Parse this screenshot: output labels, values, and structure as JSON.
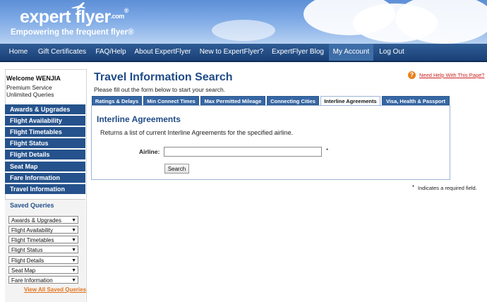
{
  "brand": {
    "logo_text": "expert flyer",
    "logo_suffix": ".com",
    "logo_mark": "®",
    "tagline": "Empowering the frequent flyer®"
  },
  "nav": {
    "items": [
      {
        "label": "Home"
      },
      {
        "label": "Gift Certificates"
      },
      {
        "label": "FAQ/Help"
      },
      {
        "label": "About ExpertFlyer"
      },
      {
        "label": "New to ExpertFlyer?"
      },
      {
        "label": "ExpertFlyer Blog"
      },
      {
        "label": "My Account"
      },
      {
        "label": "Log Out"
      }
    ],
    "active": "My Account"
  },
  "sidebar": {
    "welcome": "Welcome WENJIA",
    "service_lines": [
      "Premium Service",
      "Unlimited Queries"
    ],
    "links": [
      {
        "label": "Awards & Upgrades"
      },
      {
        "label": "Flight Availability"
      },
      {
        "label": "Flight Timetables"
      },
      {
        "label": "Flight Status"
      },
      {
        "label": "Flight Details"
      },
      {
        "label": "Seat Map"
      },
      {
        "label": "Fare Information"
      },
      {
        "label": "Travel Information"
      }
    ],
    "saved_queries": {
      "title": "Saved Queries",
      "selects": [
        {
          "label": "Awards & Upgrades"
        },
        {
          "label": "Flight Availability"
        },
        {
          "label": "Flight Timetables"
        },
        {
          "label": "Flight Status"
        },
        {
          "label": "Flight Details"
        },
        {
          "label": "Seat Map"
        },
        {
          "label": "Fare Information"
        }
      ],
      "view_all": "View All Saved Queries"
    }
  },
  "main": {
    "title": "Travel Information Search",
    "subtitle": "Please fill out the form below to start your search.",
    "help_link": "Need Help With This Page?",
    "tabs": [
      {
        "label": "Ratings & Delays"
      },
      {
        "label": "Min Connect Times"
      },
      {
        "label": "Max Permitted Mileage"
      },
      {
        "label": "Connecting Cities"
      },
      {
        "label": "Interline Agreements"
      },
      {
        "label": "Visa, Health & Passport"
      }
    ],
    "active_tab": "Interline Agreements",
    "panel": {
      "title": "Interline Agreements",
      "description": "Returns a list of current Interline Agreements for the specified airline.",
      "airline_label": "Airline:",
      "airline_value": "",
      "required_mark": "*",
      "search_button": "Search"
    },
    "required_note": "Indicates a required field."
  },
  "colors": {
    "nav_bg": "#1a4177",
    "sidebar_link_bg": "#25528c",
    "title_blue": "#1f4b87",
    "accent_orange": "#e3731c",
    "help_red": "#cc2222"
  }
}
